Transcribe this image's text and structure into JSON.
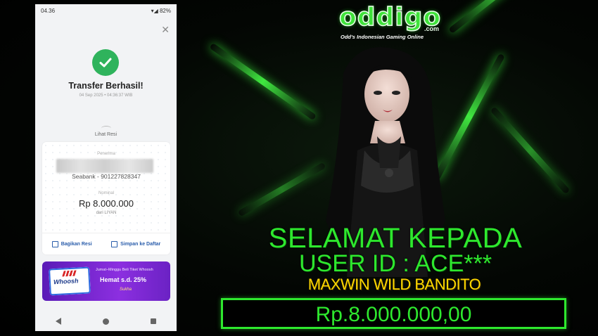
{
  "phone": {
    "status": {
      "time": "04.36",
      "battery": "82%"
    },
    "title": "Transfer Berhasil!",
    "datetime": "04 Sep 2025 • 04:36:37 WIB",
    "lihat_resi": "Lihat Resi",
    "recipient_label": "Penerima",
    "account": "Seabank - 901227828347",
    "nominal_label": "Nominal",
    "amount": "Rp 8.000.000",
    "from": "dari LIYAN",
    "actions": {
      "share": "Bagikan Resi",
      "save": "Simpan ke Daftar"
    },
    "promo": {
      "brand": "Whoosh",
      "small_text": "Jumat–Minggu Beli Tiket Whoosh",
      "big_text": "Hemat s.d. 25%",
      "sign": "Sukha"
    }
  },
  "brand": {
    "logo": "oddigo",
    "logo_suffix": ".com",
    "tagline": "Odd's Indonesian Gaming Online"
  },
  "banner": {
    "line1": "SELAMAT KEPADA",
    "line2": "USER ID : ACE***",
    "game": "MAXWIN WILD BANDITO",
    "prize": "Rp.8.000.000,00"
  },
  "colors": {
    "accent_green": "#2ee82e",
    "gold": "#ffd800",
    "success": "#2fb35c",
    "link_blue": "#2a5dab"
  }
}
